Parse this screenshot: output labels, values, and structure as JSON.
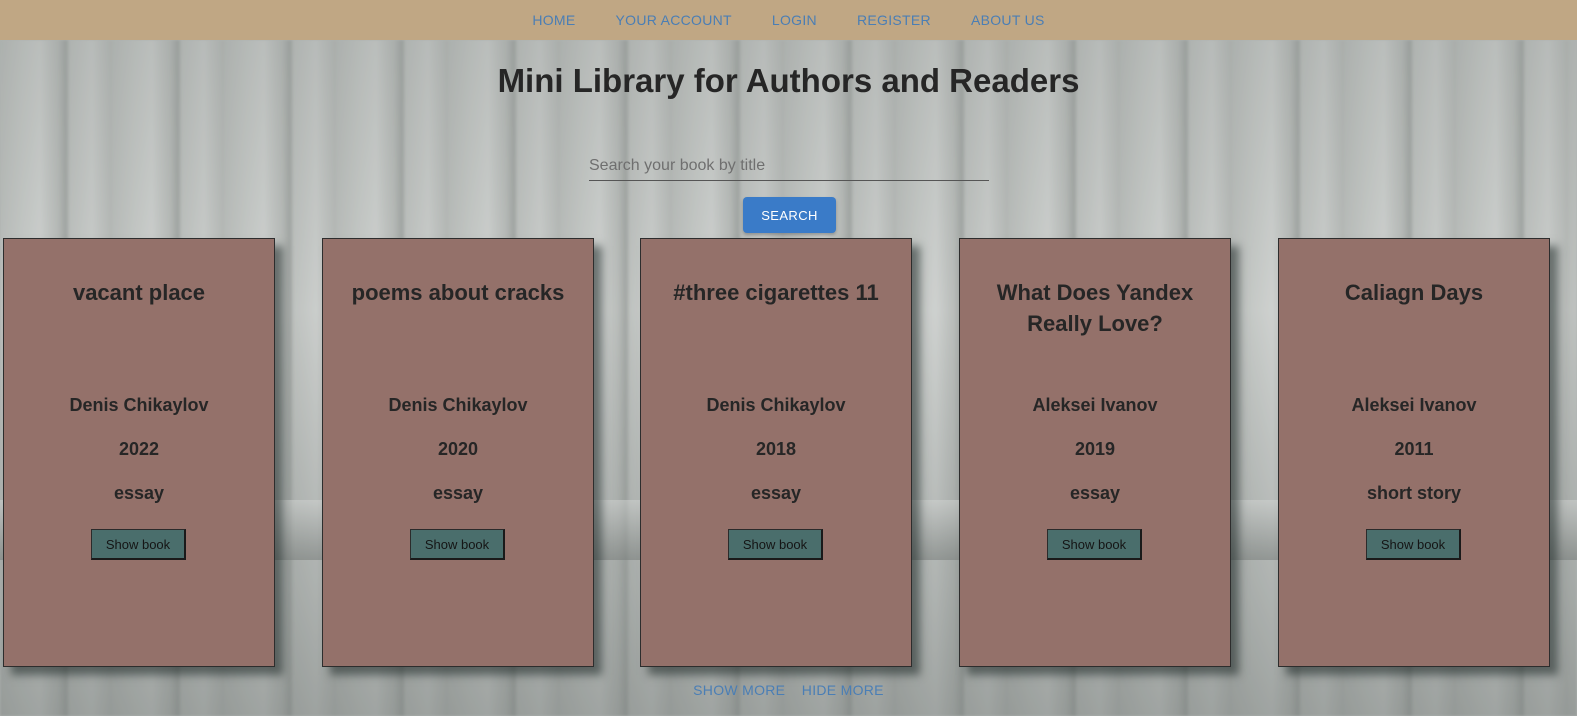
{
  "nav": {
    "items": [
      {
        "label": "HOME"
      },
      {
        "label": "YOUR ACCOUNT"
      },
      {
        "label": "LOGIN"
      },
      {
        "label": "REGISTER"
      },
      {
        "label": "ABOUT US"
      }
    ]
  },
  "header": {
    "title": "Mini Library for Authors and Readers"
  },
  "search": {
    "placeholder": "Search your book by title",
    "value": "",
    "button_label": "SEARCH"
  },
  "books": [
    {
      "title": "vacant place",
      "author": "Denis Chikaylov",
      "year": "2022",
      "genre": "essay",
      "button_label": "Show book"
    },
    {
      "title": "poems about cracks",
      "author": "Denis Chikaylov",
      "year": "2020",
      "genre": "essay",
      "button_label": "Show book"
    },
    {
      "title": "#three cigarettes 11",
      "author": "Denis Chikaylov",
      "year": "2018",
      "genre": "essay",
      "button_label": "Show book"
    },
    {
      "title": "What Does Yandex Really Love?",
      "author": "Aleksei Ivanov",
      "year": "2019",
      "genre": "essay",
      "button_label": "Show book"
    },
    {
      "title": "Caliagn Days",
      "author": "Aleksei Ivanov",
      "year": "2011",
      "genre": "short story",
      "button_label": "Show book"
    }
  ],
  "footer": {
    "show_more_label": "SHOW MORE",
    "hide_more_label": "HIDE MORE"
  },
  "colors": {
    "nav_background": "#c0a784",
    "link": "#4a7eb5",
    "card_background": "#94716a",
    "card_button": "#4a6e6c",
    "search_button": "#3a7bc8"
  }
}
